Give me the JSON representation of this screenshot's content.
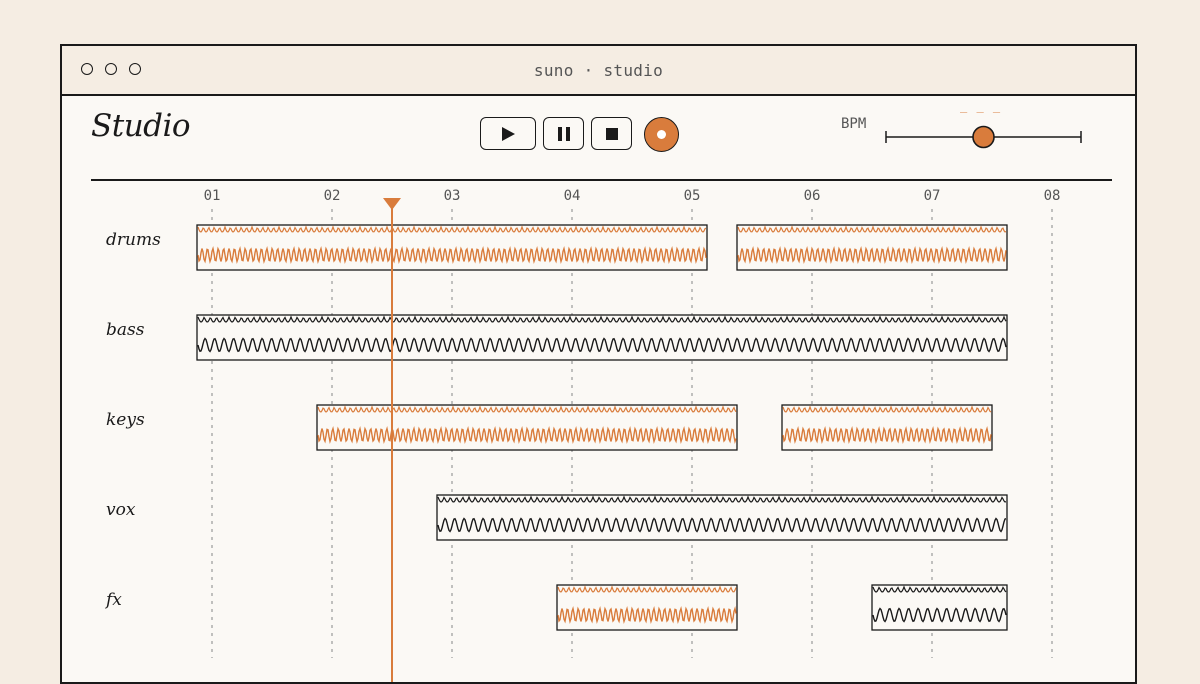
{
  "window": {
    "title": "suno · studio",
    "controls": [
      "close-dot",
      "minimize-dot",
      "maximize-dot"
    ]
  },
  "app": {
    "title": "Studio"
  },
  "transport": {
    "buttons": [
      {
        "name": "play-button",
        "icon": "play-icon"
      },
      {
        "name": "pause-button",
        "icon": "pause-icon"
      },
      {
        "name": "stop-button",
        "icon": "stop-icon"
      },
      {
        "name": "record-button",
        "icon": "record-icon"
      }
    ]
  },
  "bpm": {
    "label": "BPM",
    "value_display": "_ _ _",
    "level": 0.5
  },
  "timeline": {
    "bars": [
      "01",
      "02",
      "03",
      "04",
      "05",
      "06",
      "07",
      "08"
    ],
    "playhead_bar": 2.5
  },
  "tracks": [
    {
      "name": "drums",
      "clips": [
        {
          "start": 0.875,
          "end": 5.125,
          "active": true
        },
        {
          "start": 5.375,
          "end": 7.625,
          "active": true
        }
      ]
    },
    {
      "name": "bass",
      "clips": [
        {
          "start": 0.875,
          "end": 7.625,
          "active": false
        }
      ]
    },
    {
      "name": "keys",
      "clips": [
        {
          "start": 1.875,
          "end": 5.375,
          "active": true
        },
        {
          "start": 5.75,
          "end": 7.5,
          "active": true
        }
      ]
    },
    {
      "name": "vox",
      "clips": [
        {
          "start": 2.875,
          "end": 7.625,
          "active": false
        }
      ]
    },
    {
      "name": "fx",
      "clips": [
        {
          "start": 3.875,
          "end": 5.375,
          "active": true
        },
        {
          "start": 6.5,
          "end": 7.625,
          "active": false
        }
      ]
    }
  ],
  "colors": {
    "accent": "#d97c3c",
    "ink": "#1a1a1a",
    "muted": "#555555",
    "background": "#f5ede3",
    "panel": "#fbf9f5"
  }
}
